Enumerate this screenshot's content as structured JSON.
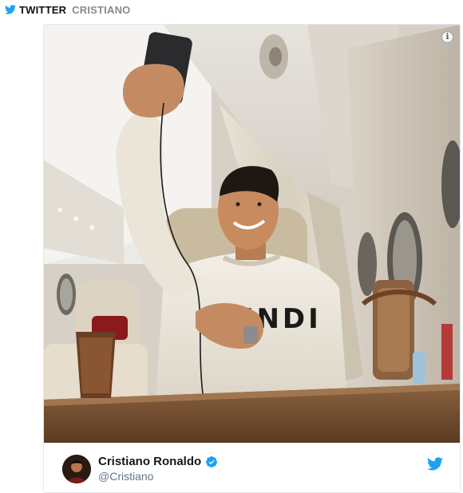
{
  "source": {
    "network_label": "TWITTER",
    "account_label": "CRISTIANO",
    "icon": "twitter-bird-icon",
    "accent_color": "#1da1f2"
  },
  "tweet": {
    "media": {
      "info_icon_glyph": "i",
      "sweater_text": "FENDI"
    },
    "author": {
      "display_name": "Cristiano Ronaldo",
      "handle": "@Cristiano",
      "verified": true,
      "verified_icon": "verified-badge-icon",
      "avatar_icon": "avatar"
    },
    "brand_icon": "twitter-logo-icon",
    "brand_color": "#1da1f2"
  }
}
